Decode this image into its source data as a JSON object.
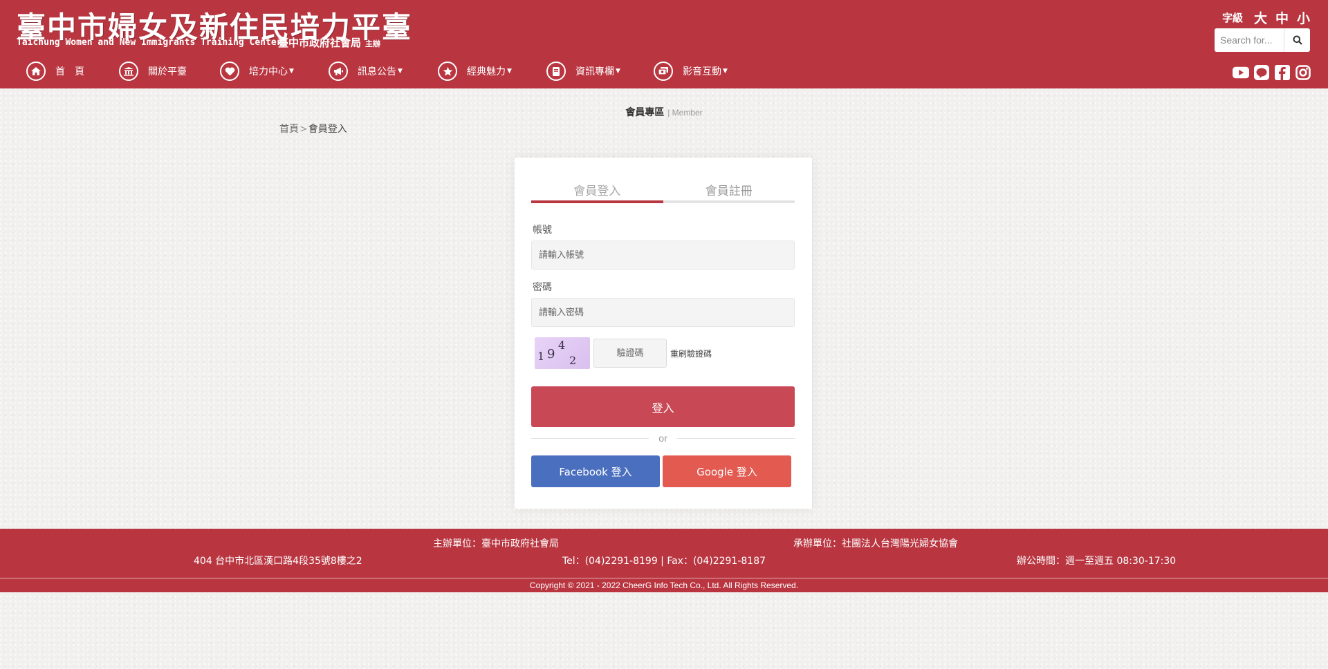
{
  "header": {
    "logo_title": "臺中市婦女及新住民培力平臺",
    "logo_subtitle_en": "Taichung Women and New Immigrants Training Center",
    "logo_subtitle_zh": "臺中市政府社會局",
    "logo_subtitle_tag": "主辦",
    "font_size_label": "字級",
    "font_sizes": [
      "大",
      "中",
      "小"
    ],
    "search_placeholder": "Search for..."
  },
  "nav": {
    "items": [
      {
        "label": "首　頁",
        "icon": "home-icon",
        "dropdown": false
      },
      {
        "label": "關於平臺",
        "icon": "building-icon",
        "dropdown": false
      },
      {
        "label": "培力中心",
        "icon": "heart-icon",
        "dropdown": true
      },
      {
        "label": "訊息公告",
        "icon": "megaphone-icon",
        "dropdown": true
      },
      {
        "label": "經典魅力",
        "icon": "star-icon",
        "dropdown": true
      },
      {
        "label": "資訊專欄",
        "icon": "book-icon",
        "dropdown": true
      },
      {
        "label": "影音互動",
        "icon": "media-icon",
        "dropdown": true
      }
    ],
    "social": [
      "youtube-icon",
      "line-icon",
      "facebook-icon",
      "instagram-icon"
    ]
  },
  "page": {
    "section_title": "會員專區",
    "section_title_en": "Member",
    "breadcrumb_home": "首頁",
    "breadcrumb_sep": ">",
    "breadcrumb_current": "會員登入"
  },
  "login": {
    "tab_login": "會員登入",
    "tab_register": "會員註冊",
    "account_label": "帳號",
    "account_placeholder": "請輸入帳號",
    "password_label": "密碼",
    "password_placeholder": "請輸入密碼",
    "captcha_digits": [
      "1",
      "9",
      "4",
      "2"
    ],
    "captcha_placeholder": "驗證碼",
    "refresh_captcha": "重刷驗證碼",
    "login_button": "登入",
    "or_text": "or",
    "facebook_button": "Facebook 登入",
    "google_button": "Google 登入"
  },
  "footer": {
    "organizer": "主辦單位：臺中市政府社會局",
    "contractor": "承辦單位：社團法人台灣陽光婦女協會",
    "address": "404 台中市北區漢口路4段35號8樓之2",
    "phone_fax": "Tel：(04)2291-8199 | Fax：(04)2291-8187",
    "office_hours": "辦公時間：週一至週五 08:30-17:30",
    "copyright": "Copyright © 2021 - 2022 CheerG Info Tech Co., Ltd. All Rights Reserved."
  },
  "colors": {
    "brand": "#b93641",
    "login_button": "#c84955",
    "facebook": "#4b6fbf",
    "google": "#e25a50"
  }
}
